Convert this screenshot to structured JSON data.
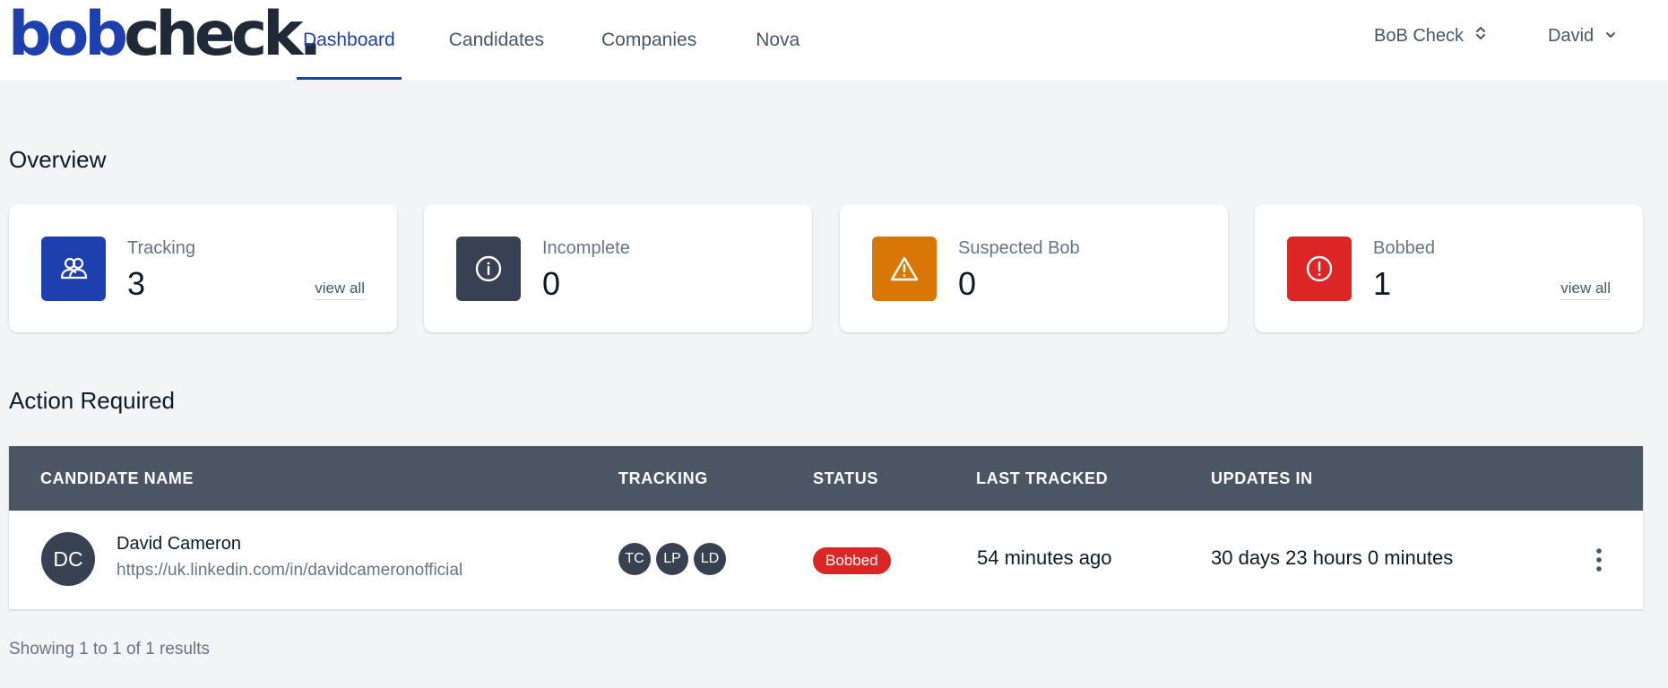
{
  "app": {
    "logo": {
      "part1": "bob",
      "part2": "check",
      "part3": "."
    }
  },
  "nav": {
    "items": [
      {
        "label": "Dashboard",
        "active": true
      },
      {
        "label": "Candidates",
        "active": false
      },
      {
        "label": "Companies",
        "active": false
      },
      {
        "label": "Nova",
        "active": false
      }
    ]
  },
  "header": {
    "org_switcher": {
      "label": "BoB Check",
      "icon": "chevron-up-down-icon"
    },
    "user_menu": {
      "label": "David",
      "icon": "chevron-down-icon"
    }
  },
  "overview": {
    "title": "Overview",
    "cards": [
      {
        "label": "Tracking",
        "value": "3",
        "link": "view all",
        "icon": "users-icon",
        "color": "#1e40af"
      },
      {
        "label": "Incomplete",
        "value": "0",
        "link": "",
        "icon": "info-icon",
        "color": "#374151"
      },
      {
        "label": "Suspected Bob",
        "value": "0",
        "link": "",
        "icon": "warning-icon",
        "color": "#d97706"
      },
      {
        "label": "Bobbed",
        "value": "1",
        "link": "view all",
        "icon": "alert-circle-icon",
        "color": "#dc2626"
      }
    ]
  },
  "action_required": {
    "title": "Action Required",
    "columns": [
      "CANDIDATE NAME",
      "TRACKING",
      "STATUS",
      "LAST TRACKED",
      "UPDATES IN"
    ],
    "rows": [
      {
        "initials": "DC",
        "name": "David Cameron",
        "linkedin": "https://uk.linkedin.com/in/davidcameronofficial",
        "trackers": [
          "TC",
          "LP",
          "LD"
        ],
        "status": "Bobbed",
        "last_tracked": "54 minutes ago",
        "updates_in": "30 days 23 hours 0 minutes"
      }
    ],
    "footer": "Showing 1 to 1 of 1 results"
  },
  "colors": {
    "brand": "#1e40af",
    "header_bg": "#4b5563",
    "status_bobbed": "#dc2626"
  }
}
